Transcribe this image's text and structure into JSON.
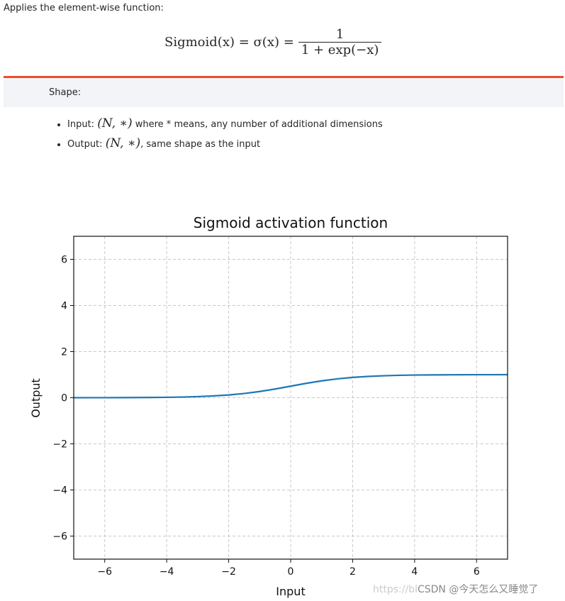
{
  "intro": "Applies the element-wise function:",
  "formula": {
    "lhs": "Sigmoid(x) = σ(x) =",
    "numerator": "1",
    "denominator": "1 + exp(−x)"
  },
  "shape": {
    "label": "Shape:",
    "items": [
      {
        "label": "Input:",
        "math": "(N, ∗)",
        "text": "where * means, any number of additional dimensions"
      },
      {
        "label": "Output:",
        "math": "(N, ∗)",
        "text": ", same shape as the input"
      }
    ]
  },
  "accent_color": "#ee4c2c",
  "chart_data": {
    "type": "line",
    "title": "Sigmoid activation function",
    "xlabel": "Input",
    "ylabel": "Output",
    "xlim": [
      -7,
      7
    ],
    "ylim": [
      -7,
      7
    ],
    "xticks": [
      -6,
      -4,
      -2,
      0,
      2,
      4,
      6
    ],
    "yticks": [
      -6,
      -4,
      -2,
      0,
      2,
      4,
      6
    ],
    "xtick_labels": [
      "−6",
      "−4",
      "−2",
      "0",
      "2",
      "4",
      "6"
    ],
    "ytick_labels": [
      "−6",
      "−4",
      "−2",
      "0",
      "2",
      "4",
      "6"
    ],
    "grid": true,
    "line_color": "#1f77b4",
    "x": [
      -7,
      -6.5,
      -6,
      -5.5,
      -5,
      -4.5,
      -4,
      -3.5,
      -3,
      -2.5,
      -2,
      -1.5,
      -1,
      -0.5,
      0,
      0.5,
      1,
      1.5,
      2,
      2.5,
      3,
      3.5,
      4,
      4.5,
      5,
      5.5,
      6,
      6.5,
      7
    ],
    "y": [
      0.0009,
      0.0015,
      0.0025,
      0.0041,
      0.0067,
      0.011,
      0.018,
      0.0293,
      0.0474,
      0.0759,
      0.1192,
      0.1824,
      0.2689,
      0.3775,
      0.5,
      0.6225,
      0.7311,
      0.8176,
      0.8808,
      0.9241,
      0.9526,
      0.9707,
      0.982,
      0.989,
      0.9933,
      0.9959,
      0.9975,
      0.9985,
      0.9991
    ]
  },
  "watermark": {
    "faint": "https://bl",
    "text": "CSDN @今天怎么又睡觉了"
  }
}
